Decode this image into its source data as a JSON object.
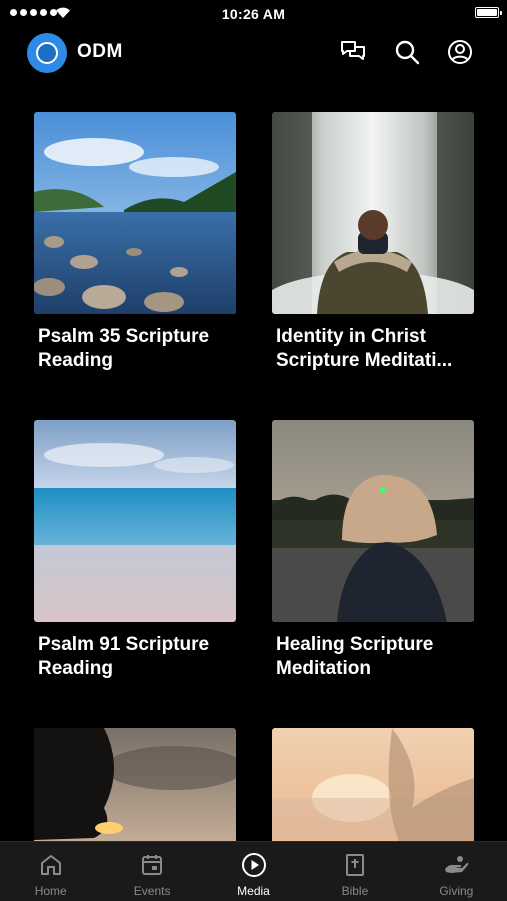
{
  "status_bar": {
    "time": "10:26 AM"
  },
  "header": {
    "app_name": "ODM",
    "icons": [
      "chat-icon",
      "search-icon",
      "account-icon"
    ]
  },
  "media_items": [
    {
      "title": "Psalm 35 Scripture Reading",
      "thumbnail": "lake-landscape"
    },
    {
      "title": "Identity in Christ Scripture Meditati...",
      "thumbnail": "waterfall-person"
    },
    {
      "title": "Psalm 91 Scripture Reading",
      "thumbnail": "ocean-beach"
    },
    {
      "title": "Healing Scripture Meditation",
      "thumbnail": "woman-lake-sunset"
    },
    {
      "title": "",
      "thumbnail": "sunset-tree"
    },
    {
      "title": "",
      "thumbnail": "sunset-hair"
    }
  ],
  "tabs": [
    {
      "label": "Home",
      "icon": "home-icon",
      "active": false
    },
    {
      "label": "Events",
      "icon": "calendar-icon",
      "active": false
    },
    {
      "label": "Media",
      "icon": "play-icon",
      "active": true
    },
    {
      "label": "Bible",
      "icon": "bible-icon",
      "active": false
    },
    {
      "label": "Giving",
      "icon": "giving-hand-icon",
      "active": false
    }
  ],
  "colors": {
    "background": "#000000",
    "tab_bar": "#1a1a1a",
    "accent": "#2e8ae6",
    "inactive_tab": "#8a8a8a"
  }
}
